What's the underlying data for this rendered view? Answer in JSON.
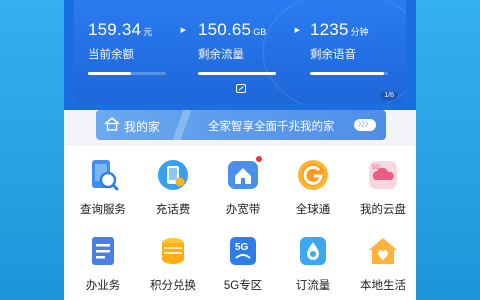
{
  "stats": [
    {
      "value": "159.34",
      "unit": "元",
      "label": "当前余额",
      "progress": 0.55
    },
    {
      "value": "150.65",
      "unit": "GB",
      "label": "剩余流量",
      "progress": 1.0
    },
    {
      "value": "1235",
      "unit": "分钟",
      "label": "剩余语音",
      "progress": 0.95
    }
  ],
  "pager": "1/6",
  "home_banner": {
    "title": "我的家",
    "slogan": "全家智享全面千兆我的家",
    "pill": "〉〉〉"
  },
  "grid": [
    {
      "label": "查询服务",
      "icon": "query-service-icon"
    },
    {
      "label": "充话费",
      "icon": "recharge-icon"
    },
    {
      "label": "办宽带",
      "icon": "broadband-icon"
    },
    {
      "label": "全球通",
      "icon": "global-link-icon"
    },
    {
      "label": "我的云盘",
      "icon": "cloud-disk-icon"
    },
    {
      "label": "办业务",
      "icon": "business-icon"
    },
    {
      "label": "积分兑换",
      "icon": "points-exchange-icon"
    },
    {
      "label": "5G专区",
      "icon": "5g-zone-icon"
    },
    {
      "label": "订流量",
      "icon": "order-data-icon"
    },
    {
      "label": "本地生活",
      "icon": "local-life-icon"
    }
  ],
  "colors": {
    "accent": "#1a6fe0",
    "page_bg": "#2aa5e6"
  }
}
